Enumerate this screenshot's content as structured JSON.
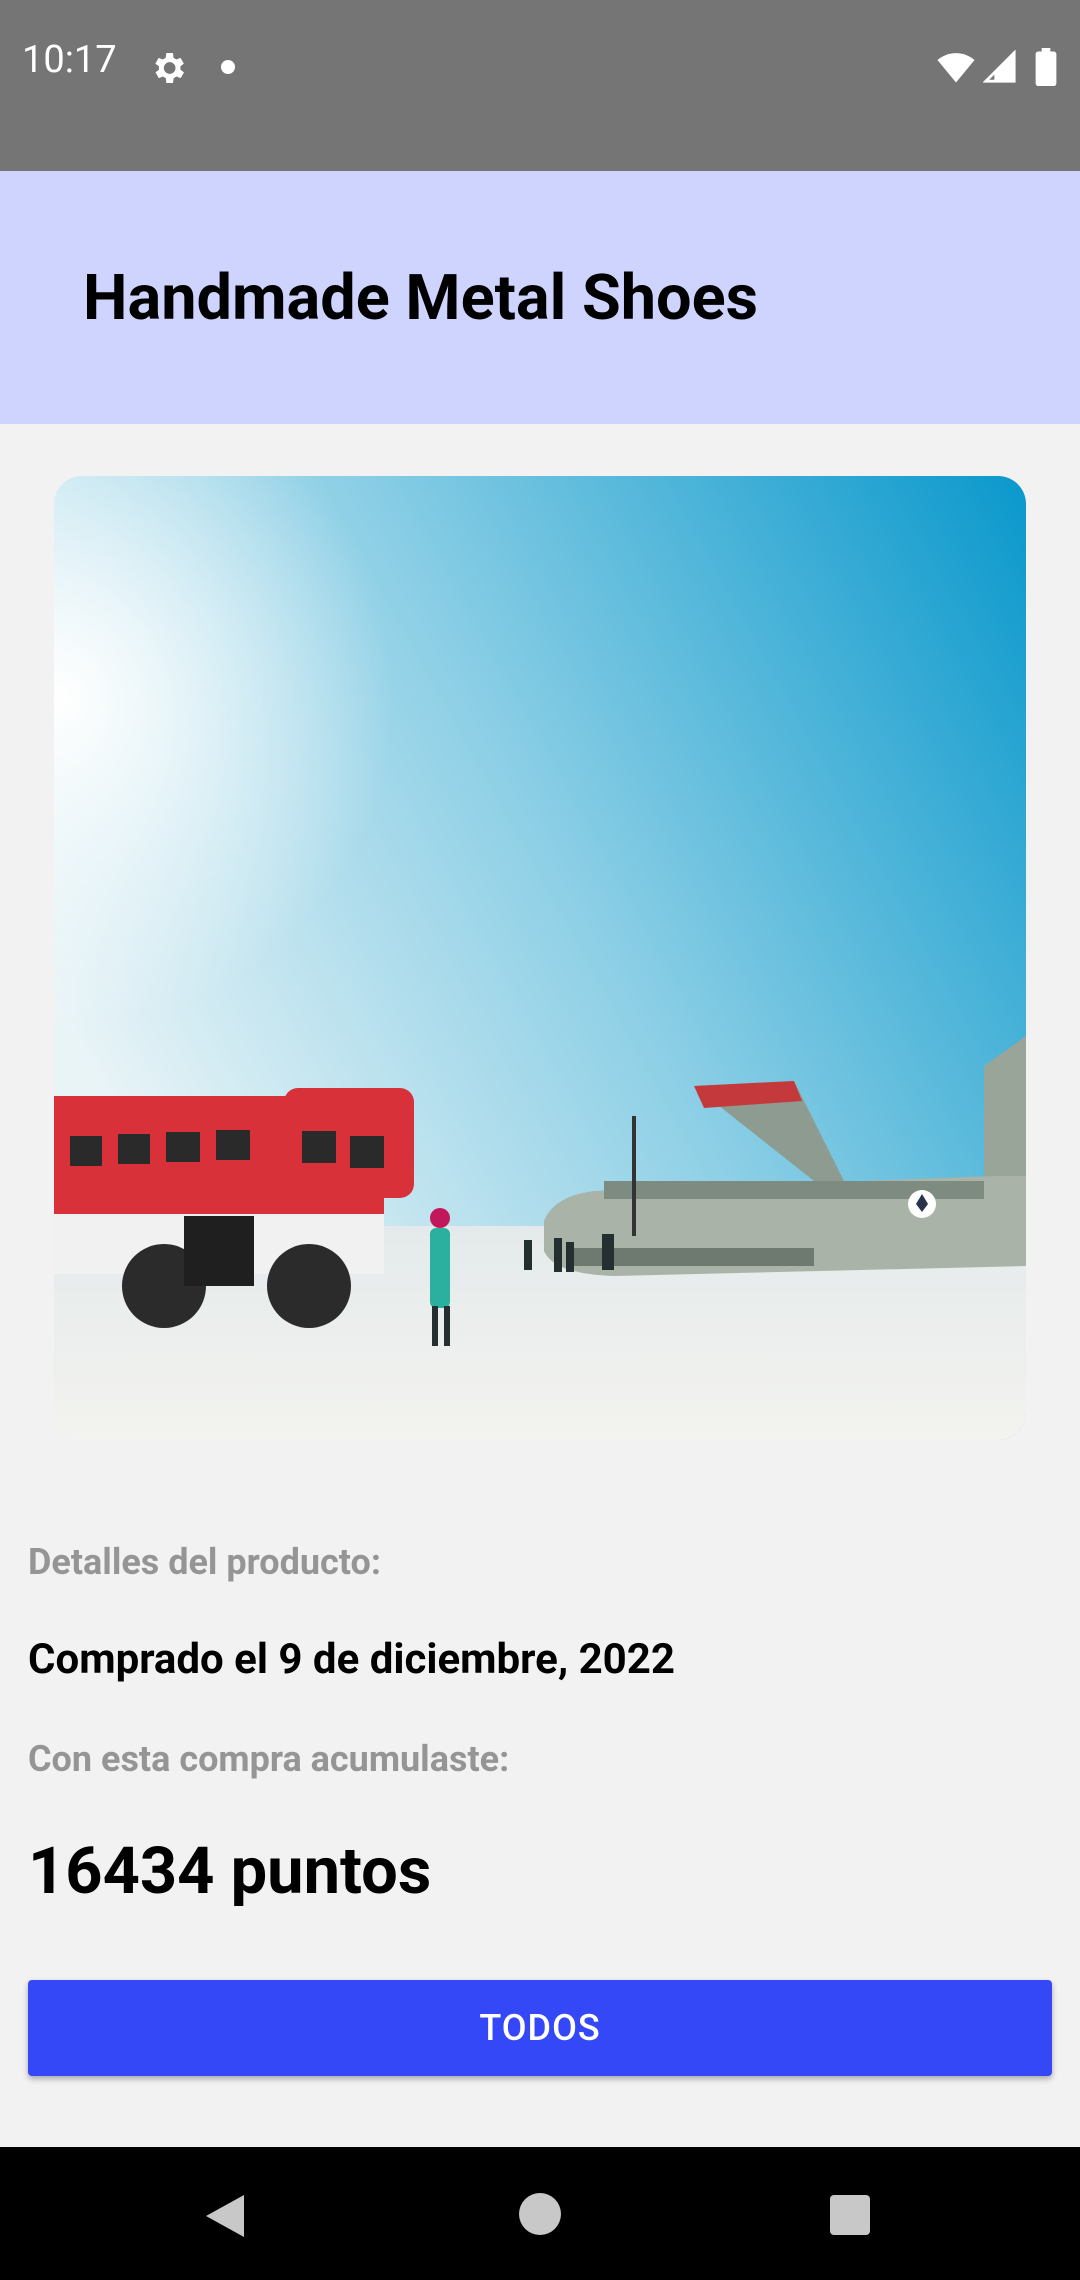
{
  "status_bar": {
    "time": "10:17",
    "icons": [
      "settings-gear-icon",
      "notification-dot-icon",
      "wifi-icon",
      "signal-icon",
      "battery-icon"
    ]
  },
  "app_bar": {
    "title": "Handmade Metal Shoes",
    "background": "#cfd4fe"
  },
  "product": {
    "image_alt": "photo",
    "details_label": "Detalles del producto:",
    "purchase_date": "Comprado el 9 de diciembre, 2022",
    "accumulated_label": "Con esta compra acumulaste:",
    "points": "16434 puntos"
  },
  "actions": {
    "todos_label": "TODOS",
    "button_color": "#3548f8"
  },
  "nav_bar": {
    "icons": [
      "back-icon",
      "home-icon",
      "recents-icon"
    ]
  }
}
